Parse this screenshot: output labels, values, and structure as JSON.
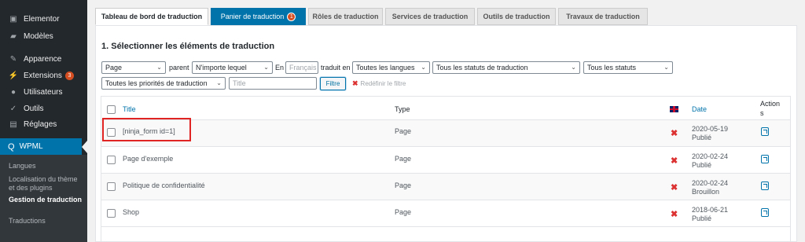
{
  "sidebar": {
    "items": [
      {
        "icon": "elementor-icon",
        "label": "Elementor"
      },
      {
        "icon": "folder-icon",
        "label": "Modèles"
      },
      {
        "icon": "brush-icon",
        "label": "Apparence"
      },
      {
        "icon": "plugin-icon",
        "label": "Extensions",
        "badge": "3"
      },
      {
        "icon": "users-icon",
        "label": "Utilisateurs"
      },
      {
        "icon": "wrench-icon",
        "label": "Outils"
      },
      {
        "icon": "settings-icon",
        "label": "Réglages"
      }
    ],
    "active": {
      "icon": "wpml-icon",
      "label": "WPML"
    },
    "submenu": [
      {
        "label": "Langues"
      },
      {
        "label": "Localisation du thème et des plugins"
      },
      {
        "label": "Gestion de traduction"
      },
      {
        "label": "Traductions"
      }
    ]
  },
  "tabs": [
    {
      "label": "Tableau de bord de traduction"
    },
    {
      "label": "Panier de traduction",
      "badge": "1"
    },
    {
      "label": "Rôles de traduction"
    },
    {
      "label": "Services de traduction"
    },
    {
      "label": "Outils de traduction"
    },
    {
      "label": "Travaux de traduction"
    }
  ],
  "section_title": "1. Sélectionner les éléments de traduction",
  "filters": {
    "type_value": "Page",
    "parent_label": "parent",
    "parent_value": "N'importe lequel",
    "en_label": "En",
    "en_value": "Français",
    "translated_label": "traduit en",
    "lang_value": "Toutes les langues",
    "status_value": "Tous les statuts de traduction",
    "all_status_value": "Tous les statuts",
    "priority_value": "Toutes les priorités de traduction",
    "title_placeholder": "Title",
    "filter_button": "Filtre",
    "reset_label": "Redéfinir le filtre"
  },
  "table": {
    "headers": {
      "title": "Title",
      "type": "Type",
      "date": "Date",
      "actions_1": "Action",
      "actions_2": "s"
    },
    "rows": [
      {
        "title": "[ninja_form id=1]",
        "type": "Page",
        "date": "2020-05-19",
        "status": "Publié"
      },
      {
        "title": "Page d'exemple",
        "type": "Page",
        "date": "2020-02-24",
        "status": "Publié"
      },
      {
        "title": "Politique de confidentialité",
        "type": "Page",
        "date": "2020-02-24",
        "status": "Brouillon"
      },
      {
        "title": "Shop",
        "type": "Page",
        "date": "2018-06-21",
        "status": "Publié"
      }
    ]
  },
  "colors": {
    "accent": "#0073aa",
    "sidebar": "#23282d",
    "highlight_box": "#e02424"
  }
}
